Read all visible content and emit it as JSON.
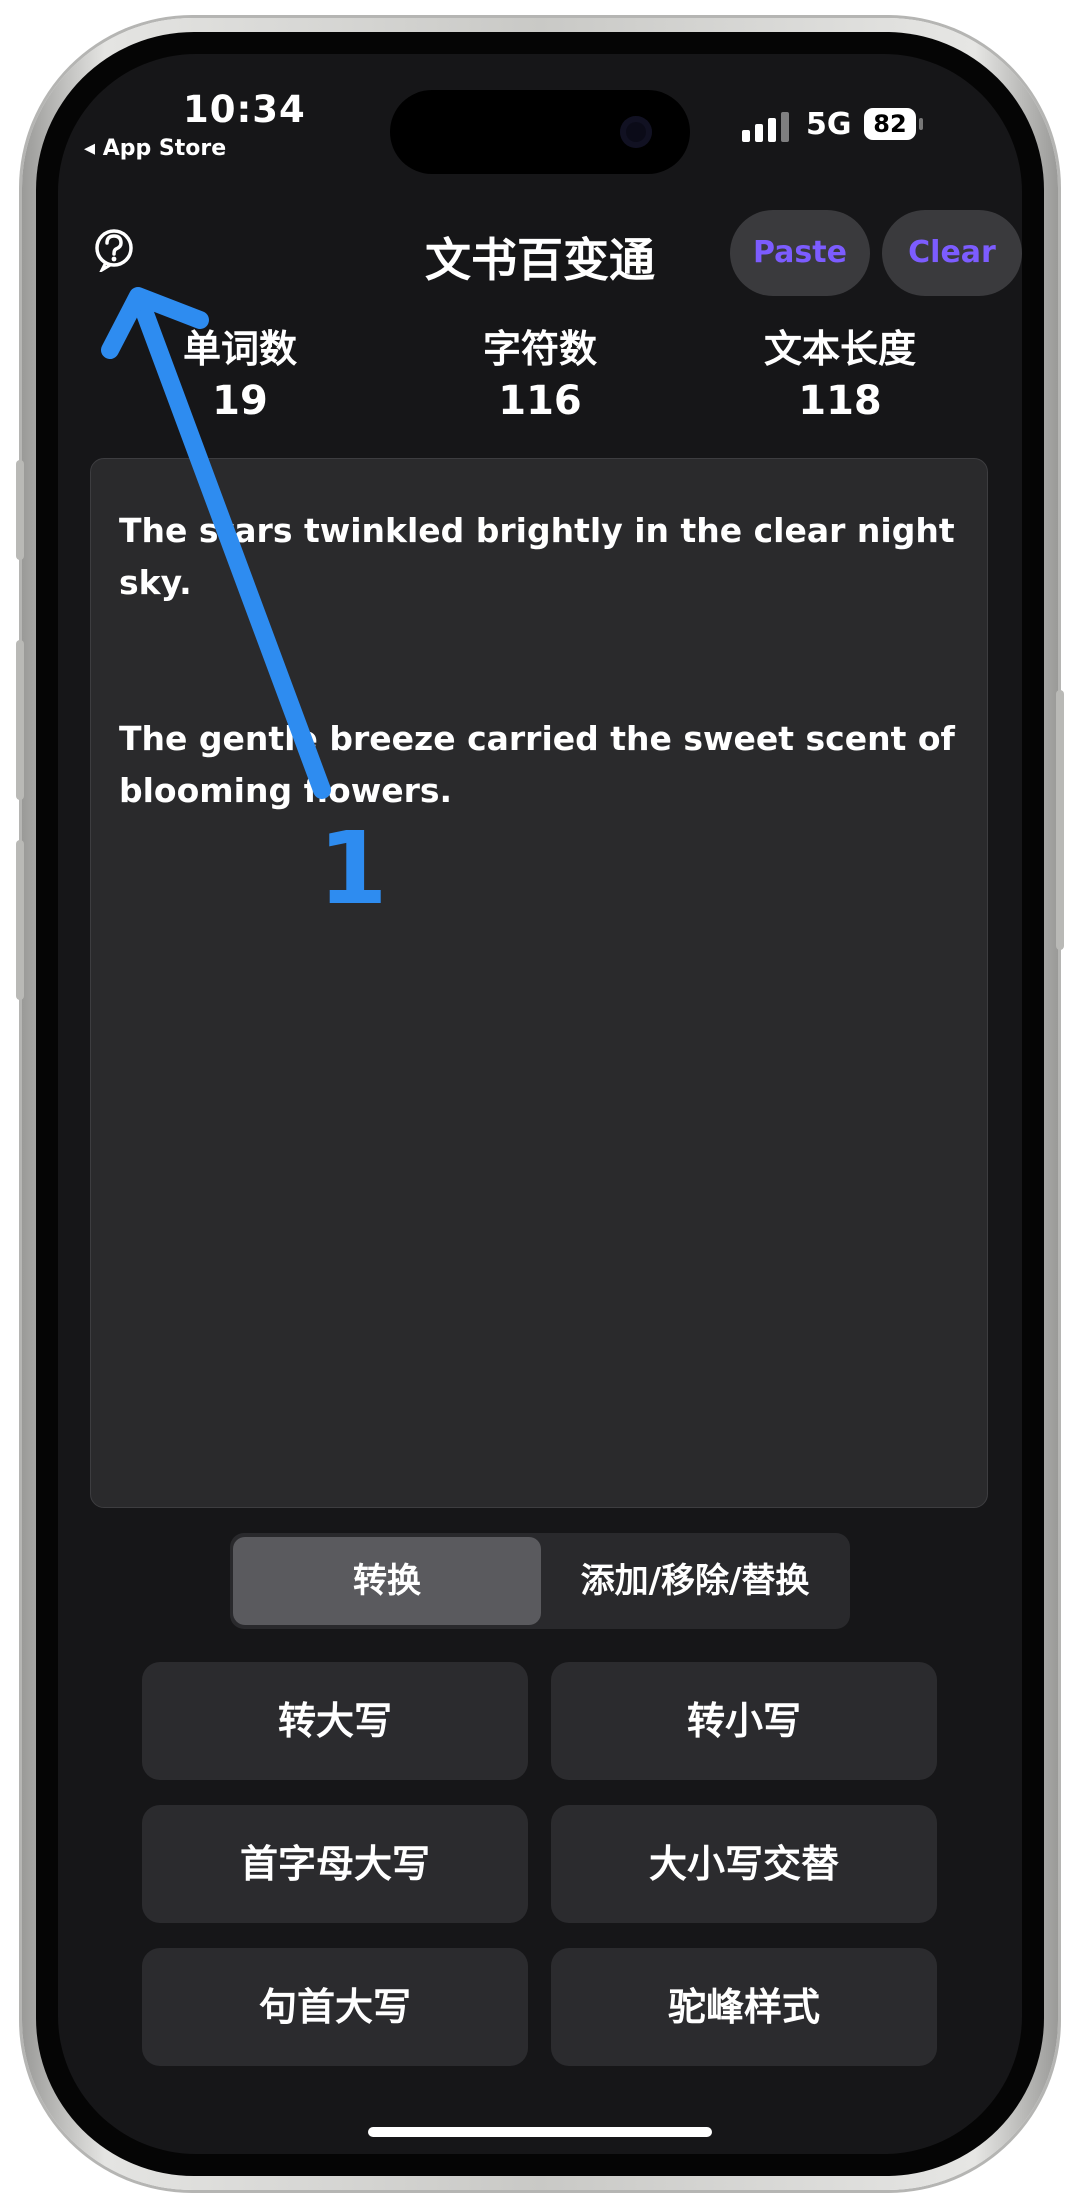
{
  "status_bar": {
    "time": "10:34",
    "back_app": "◂ App Store",
    "network": "5G",
    "battery": "82"
  },
  "header": {
    "title": "文书百变通",
    "paste_label": "Paste",
    "clear_label": "Clear",
    "help_icon": "question-circle-icon"
  },
  "stats": [
    {
      "label": "单词数",
      "value": "19"
    },
    {
      "label": "字符数",
      "value": "116"
    },
    {
      "label": "文本长度",
      "value": "118"
    }
  ],
  "editor": {
    "paragraphs": [
      "The stars  twinkled brightly in  the clear night sky.",
      "The gentle breeze carried the sweet scent of blooming flowers."
    ]
  },
  "segment": {
    "options": [
      "转换",
      "添加/移除/替换"
    ],
    "selected": "转换"
  },
  "actions": [
    "转大写",
    "转小写",
    "首字母大写",
    "大小写交替",
    "句首大写",
    "驼峰样式"
  ],
  "colors": {
    "accent": "#7c5cff",
    "annotation": "#2e8cf0",
    "background": "#161618"
  },
  "annotation": {
    "label": "1"
  }
}
